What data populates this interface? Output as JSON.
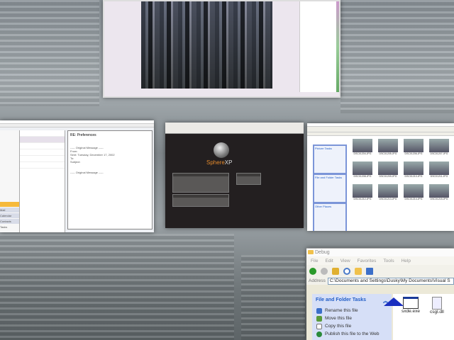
{
  "viewer": {
    "title": "Image viewer"
  },
  "outlook": {
    "reading_pane_lines": [
      "RE: Preferences",
      "----- Original Message -----",
      "From:",
      "Sent: Tuesday, December 17, 2002",
      "To:",
      "Subject:",
      "----- Original Message -----"
    ],
    "nav_buttons": [
      "Mail",
      "Calendar",
      "Contacts",
      "Tasks"
    ]
  },
  "browser": {
    "logo_main": "Sphere",
    "logo_accent": "XP"
  },
  "photo_explorer": {
    "thumbnails": [
      "DSC01204.JPG",
      "DSC01205.JPG",
      "DSC01206.JPG",
      "DSC01207.JPG",
      "DSC01208.JPG",
      "DSC01209.JPG",
      "DSC01210.JPG",
      "DSC01211.JPG",
      "DSC01212.JPG",
      "DSC01213.JPG",
      "DSC01214.JPG",
      "DSC01215.JPG"
    ],
    "task_headers": [
      "Picture Tasks",
      "File and Folder Tasks",
      "Other Places"
    ]
  },
  "debug": {
    "title": "Debug",
    "menu": [
      "File",
      "Edit",
      "View",
      "Favorites",
      "Tools",
      "Help"
    ],
    "address_label": "Address",
    "address": "C:\\Documents and Settings\\Dusky\\My Documents\\Visual S",
    "tasks_header": "File and Folder Tasks",
    "tasks": [
      "Rename this file",
      "Move this file",
      "Copy this file",
      "Publish this file to the Web"
    ],
    "files": [
      "sxde.exe",
      "csgl.dll"
    ]
  },
  "colors": {
    "task_link": "#215dc6",
    "orange_accent": "#e48a2c",
    "cursor": "#1a2fbf"
  }
}
